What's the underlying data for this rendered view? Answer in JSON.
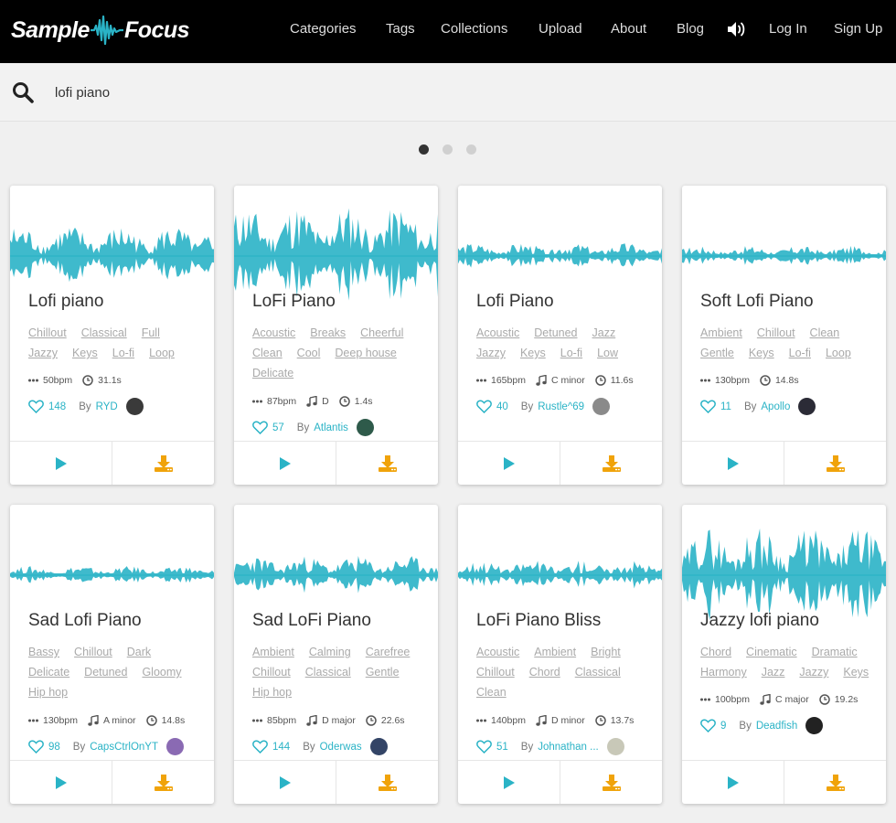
{
  "app": {
    "logo": {
      "left": "Sample",
      "right": "Focus"
    },
    "nav": [
      "Categories",
      "Tags",
      "Collections",
      "Upload",
      "About",
      "Blog"
    ],
    "login": "Log In",
    "signup": "Sign Up"
  },
  "search": {
    "value": "lofi piano",
    "placeholder": ""
  },
  "carousel": {
    "dot_count": 3,
    "active": 0
  },
  "colors": {
    "accent": "#2ab3c6",
    "download": "#f0a30a",
    "header": "#000000"
  },
  "cards": [
    {
      "title": "Lofi piano",
      "tags": [
        "Chillout",
        "Classical",
        "Full",
        "Jazzy",
        "Keys",
        "Lo-fi",
        "Loop"
      ],
      "bpm": "50bpm",
      "key": "",
      "duration": "31.1s",
      "likes": "148",
      "by": "By",
      "user": "RYD",
      "avatar": "#3a3a3a",
      "wave_amp": 0.6
    },
    {
      "title": "LoFi Piano",
      "tags": [
        "Acoustic",
        "Breaks",
        "Cheerful",
        "Clean",
        "Cool",
        "Deep house",
        "Delicate"
      ],
      "bpm": "87bpm",
      "key": "D",
      "duration": "1.4s",
      "likes": "57",
      "by": "By",
      "user": "Atlantis",
      "avatar": "#2e5a4a",
      "wave_amp": 1.0
    },
    {
      "title": "Lofi Piano",
      "tags": [
        "Acoustic",
        "Detuned",
        "Jazz",
        "Jazzy",
        "Keys",
        "Lo-fi",
        "Low"
      ],
      "bpm": "165bpm",
      "key": "C minor",
      "duration": "11.6s",
      "likes": "40",
      "by": "By",
      "user": "Rustle^69",
      "avatar": "#8a8a8a",
      "wave_amp": 0.25
    },
    {
      "title": "Soft Lofi Piano",
      "tags": [
        "Ambient",
        "Chillout",
        "Clean",
        "Gentle",
        "Keys",
        "Lo-fi",
        "Loop"
      ],
      "bpm": "130bpm",
      "key": "",
      "duration": "14.8s",
      "likes": "11",
      "by": "By",
      "user": "Apollo",
      "avatar": "#2b2b36",
      "wave_amp": 0.2
    },
    {
      "title": "Sad Lofi Piano",
      "tags": [
        "Bassy",
        "Chillout",
        "Dark",
        "Delicate",
        "Detuned",
        "Gloomy",
        "Hip hop"
      ],
      "bpm": "130bpm",
      "key": "A minor",
      "duration": "14.8s",
      "likes": "98",
      "by": "By",
      "user": "CapsCtrlOnYT",
      "avatar": "#8a6ab3",
      "wave_amp": 0.18
    },
    {
      "title": "Sad LoFi Piano",
      "tags": [
        "Ambient",
        "Calming",
        "Carefree",
        "Chillout",
        "Classical",
        "Gentle",
        "Hip hop"
      ],
      "bpm": "85bpm",
      "key": "D major",
      "duration": "22.6s",
      "likes": "144",
      "by": "By",
      "user": "Oderwas",
      "avatar": "#334466",
      "wave_amp": 0.38
    },
    {
      "title": "LoFi Piano Bliss",
      "tags": [
        "Acoustic",
        "Ambient",
        "Bright",
        "Chillout",
        "Chord",
        "Classical",
        "Clean"
      ],
      "bpm": "140bpm",
      "key": "D minor",
      "duration": "13.7s",
      "likes": "51",
      "by": "By",
      "user": "Johnathan ...",
      "avatar": "#c8c8b8",
      "wave_amp": 0.3
    },
    {
      "title": "Jazzy lofi piano",
      "tags": [
        "Chord",
        "Cinematic",
        "Dramatic",
        "Harmony",
        "Jazz",
        "Jazzy",
        "Keys"
      ],
      "bpm": "100bpm",
      "key": "C major",
      "duration": "19.2s",
      "likes": "9",
      "by": "By",
      "user": "Deadfish",
      "avatar": "#222222",
      "wave_amp": 0.95
    }
  ]
}
